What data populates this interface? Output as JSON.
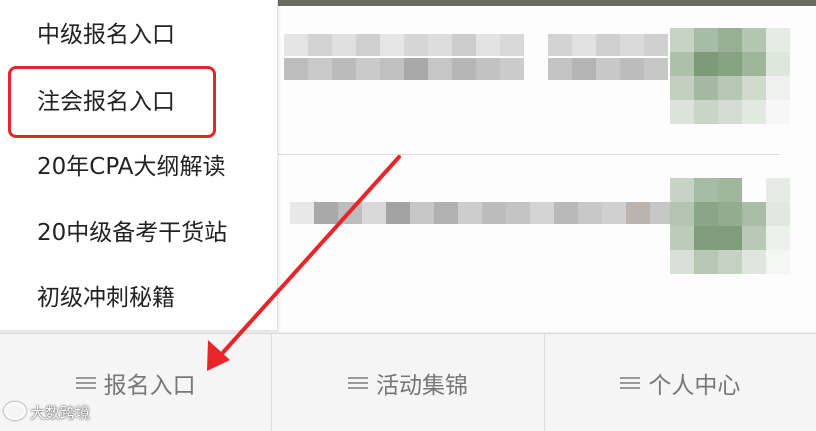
{
  "dropdown": {
    "items": [
      {
        "label": "中级报名入口"
      },
      {
        "label": "注会报名入口"
      },
      {
        "label": "20年CPA大纲解读"
      },
      {
        "label": "20中级备考干货站"
      },
      {
        "label": "初级冲刺秘籍"
      }
    ],
    "highlighted_index": 1
  },
  "bottom_nav": {
    "items": [
      {
        "label": "报名入口",
        "icon": "hamburger-icon"
      },
      {
        "label": "活动集锦",
        "icon": "hamburger-icon"
      },
      {
        "label": "个人中心",
        "icon": "hamburger-icon"
      }
    ]
  },
  "watermark": {
    "text": "大数跨境"
  },
  "colors": {
    "highlight": "#e8262a",
    "arrow": "#e8262a",
    "menu_text": "#222222",
    "nav_text": "#777777"
  }
}
